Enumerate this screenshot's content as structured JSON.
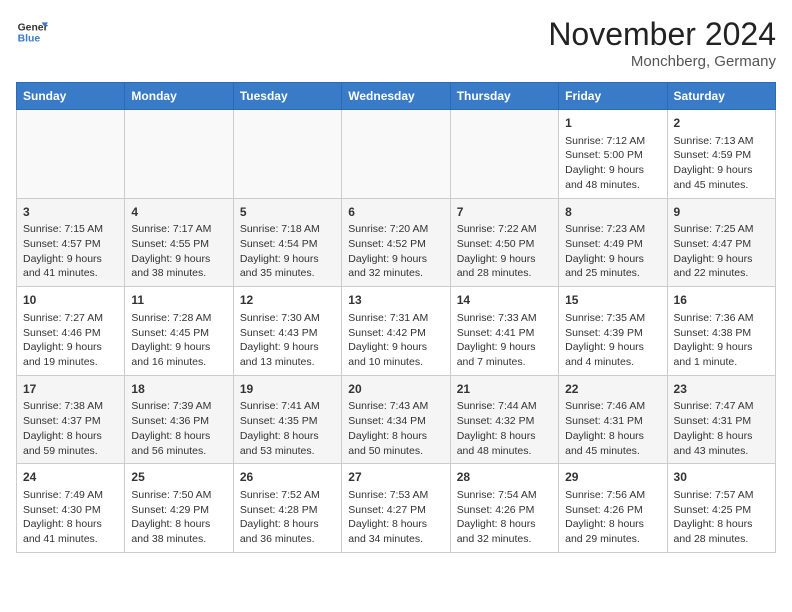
{
  "logo": {
    "line1": "General",
    "line2": "Blue"
  },
  "title": "November 2024",
  "location": "Monchberg, Germany",
  "weekdays": [
    "Sunday",
    "Monday",
    "Tuesday",
    "Wednesday",
    "Thursday",
    "Friday",
    "Saturday"
  ],
  "weeks": [
    [
      {
        "day": "",
        "info": ""
      },
      {
        "day": "",
        "info": ""
      },
      {
        "day": "",
        "info": ""
      },
      {
        "day": "",
        "info": ""
      },
      {
        "day": "",
        "info": ""
      },
      {
        "day": "1",
        "info": "Sunrise: 7:12 AM\nSunset: 5:00 PM\nDaylight: 9 hours and 48 minutes."
      },
      {
        "day": "2",
        "info": "Sunrise: 7:13 AM\nSunset: 4:59 PM\nDaylight: 9 hours and 45 minutes."
      }
    ],
    [
      {
        "day": "3",
        "info": "Sunrise: 7:15 AM\nSunset: 4:57 PM\nDaylight: 9 hours and 41 minutes."
      },
      {
        "day": "4",
        "info": "Sunrise: 7:17 AM\nSunset: 4:55 PM\nDaylight: 9 hours and 38 minutes."
      },
      {
        "day": "5",
        "info": "Sunrise: 7:18 AM\nSunset: 4:54 PM\nDaylight: 9 hours and 35 minutes."
      },
      {
        "day": "6",
        "info": "Sunrise: 7:20 AM\nSunset: 4:52 PM\nDaylight: 9 hours and 32 minutes."
      },
      {
        "day": "7",
        "info": "Sunrise: 7:22 AM\nSunset: 4:50 PM\nDaylight: 9 hours and 28 minutes."
      },
      {
        "day": "8",
        "info": "Sunrise: 7:23 AM\nSunset: 4:49 PM\nDaylight: 9 hours and 25 minutes."
      },
      {
        "day": "9",
        "info": "Sunrise: 7:25 AM\nSunset: 4:47 PM\nDaylight: 9 hours and 22 minutes."
      }
    ],
    [
      {
        "day": "10",
        "info": "Sunrise: 7:27 AM\nSunset: 4:46 PM\nDaylight: 9 hours and 19 minutes."
      },
      {
        "day": "11",
        "info": "Sunrise: 7:28 AM\nSunset: 4:45 PM\nDaylight: 9 hours and 16 minutes."
      },
      {
        "day": "12",
        "info": "Sunrise: 7:30 AM\nSunset: 4:43 PM\nDaylight: 9 hours and 13 minutes."
      },
      {
        "day": "13",
        "info": "Sunrise: 7:31 AM\nSunset: 4:42 PM\nDaylight: 9 hours and 10 minutes."
      },
      {
        "day": "14",
        "info": "Sunrise: 7:33 AM\nSunset: 4:41 PM\nDaylight: 9 hours and 7 minutes."
      },
      {
        "day": "15",
        "info": "Sunrise: 7:35 AM\nSunset: 4:39 PM\nDaylight: 9 hours and 4 minutes."
      },
      {
        "day": "16",
        "info": "Sunrise: 7:36 AM\nSunset: 4:38 PM\nDaylight: 9 hours and 1 minute."
      }
    ],
    [
      {
        "day": "17",
        "info": "Sunrise: 7:38 AM\nSunset: 4:37 PM\nDaylight: 8 hours and 59 minutes."
      },
      {
        "day": "18",
        "info": "Sunrise: 7:39 AM\nSunset: 4:36 PM\nDaylight: 8 hours and 56 minutes."
      },
      {
        "day": "19",
        "info": "Sunrise: 7:41 AM\nSunset: 4:35 PM\nDaylight: 8 hours and 53 minutes."
      },
      {
        "day": "20",
        "info": "Sunrise: 7:43 AM\nSunset: 4:34 PM\nDaylight: 8 hours and 50 minutes."
      },
      {
        "day": "21",
        "info": "Sunrise: 7:44 AM\nSunset: 4:32 PM\nDaylight: 8 hours and 48 minutes."
      },
      {
        "day": "22",
        "info": "Sunrise: 7:46 AM\nSunset: 4:31 PM\nDaylight: 8 hours and 45 minutes."
      },
      {
        "day": "23",
        "info": "Sunrise: 7:47 AM\nSunset: 4:31 PM\nDaylight: 8 hours and 43 minutes."
      }
    ],
    [
      {
        "day": "24",
        "info": "Sunrise: 7:49 AM\nSunset: 4:30 PM\nDaylight: 8 hours and 41 minutes."
      },
      {
        "day": "25",
        "info": "Sunrise: 7:50 AM\nSunset: 4:29 PM\nDaylight: 8 hours and 38 minutes."
      },
      {
        "day": "26",
        "info": "Sunrise: 7:52 AM\nSunset: 4:28 PM\nDaylight: 8 hours and 36 minutes."
      },
      {
        "day": "27",
        "info": "Sunrise: 7:53 AM\nSunset: 4:27 PM\nDaylight: 8 hours and 34 minutes."
      },
      {
        "day": "28",
        "info": "Sunrise: 7:54 AM\nSunset: 4:26 PM\nDaylight: 8 hours and 32 minutes."
      },
      {
        "day": "29",
        "info": "Sunrise: 7:56 AM\nSunset: 4:26 PM\nDaylight: 8 hours and 29 minutes."
      },
      {
        "day": "30",
        "info": "Sunrise: 7:57 AM\nSunset: 4:25 PM\nDaylight: 8 hours and 28 minutes."
      }
    ]
  ]
}
